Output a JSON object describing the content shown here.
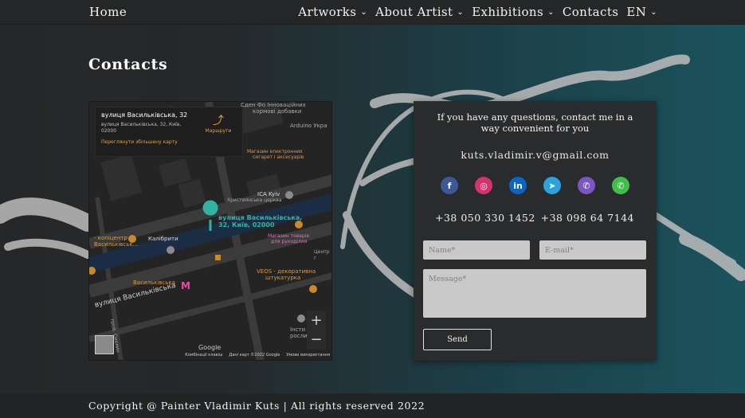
{
  "nav": {
    "home": "Home",
    "items": [
      {
        "label": "Artworks",
        "has_dropdown": true
      },
      {
        "label": "About Artist",
        "has_dropdown": true
      },
      {
        "label": "Exhibitions",
        "has_dropdown": true
      },
      {
        "label": "Contacts",
        "has_dropdown": false
      },
      {
        "label": "EN",
        "has_dropdown": true
      }
    ],
    "caret": "⌄"
  },
  "page_title": "Contacts",
  "map": {
    "card": {
      "title": "вулиця Васильківська, 32",
      "subtitle": "вулиця Васильківська, 32, Київ, 02000",
      "link": "Переглянути збільшену карту",
      "route_label": "Маршрути"
    },
    "labels": {
      "top_cut": "Сден Фо Інноваційних",
      "top_cut2": "кормові добавки",
      "arduino": "Arduino Укра",
      "shop1": "Магазин електронних",
      "shop1b": "сигарет і аксесуарів",
      "ica": "ICA Kyiv",
      "ica_sub": "Християнська церква",
      "pin": "вулиця Васильківська,",
      "pin2": "32, Київ, 02000",
      "kopi": "- копіцентр",
      "kopi2": "Васильківськ...",
      "kalibr": "Калібрити",
      "goods": "Магазин товарів",
      "goods2": "для рукоділля",
      "center": "Центр г",
      "veos": "VEOS - декоративна",
      "veos2": "штукатурка",
      "metro": "Васильківська",
      "street": "вулиця Васильківська",
      "side": "пров. Смолин",
      "inst": "Інсти",
      "inst2": "росли"
    },
    "zoom_in": "+",
    "zoom_out": "−",
    "google": "Google",
    "footer": {
      "keys": "Комбінації клавіш",
      "data": "Дані карт ©2022 Google",
      "terms": "Умови використання"
    }
  },
  "contact": {
    "intro": "If you have any questions, contact me in a way convenient for you",
    "email": "kuts.vladimir.v@gmail.com",
    "socials": [
      {
        "name": "facebook",
        "glyph": "f",
        "color": "#3b5998"
      },
      {
        "name": "instagram",
        "glyph": "◎",
        "color": "#d6336c"
      },
      {
        "name": "linkedin",
        "glyph": "in",
        "color": "#0a66c2"
      },
      {
        "name": "telegram",
        "glyph": "➤",
        "color": "#2aa3de"
      },
      {
        "name": "viber",
        "glyph": "✆",
        "color": "#7d57c1"
      },
      {
        "name": "whatsapp",
        "glyph": "✆",
        "color": "#3fbf4a"
      }
    ],
    "phones": [
      "+38 050 330 1452",
      "+38 098 64 7144"
    ],
    "form": {
      "name_placeholder": "Name*",
      "email_placeholder": "E-mail*",
      "message_placeholder": "Message*",
      "send_label": "Send"
    }
  },
  "footer": {
    "copyright": "Copyright @ Painter Vladimir Kuts | All rights reserved 2022"
  }
}
